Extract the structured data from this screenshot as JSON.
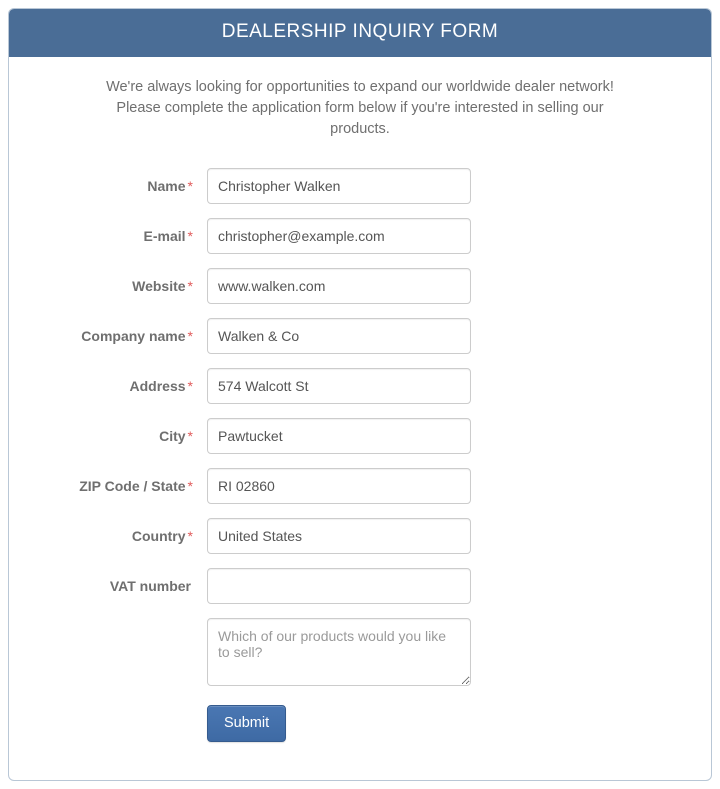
{
  "header": {
    "title": "DEALERSHIP INQUIRY FORM"
  },
  "intro": "We're always looking for opportunities to expand our worldwide dealer network! Please complete the application form below if you're interested in selling our products.",
  "fields": {
    "name": {
      "label": "Name",
      "value": "Christopher Walken",
      "required": "*"
    },
    "email": {
      "label": "E-mail",
      "value": "christopher@example.com",
      "required": "*"
    },
    "website": {
      "label": "Website",
      "value": "www.walken.com",
      "required": "*"
    },
    "company": {
      "label": "Company name",
      "value": "Walken & Co",
      "required": "*"
    },
    "address": {
      "label": "Address",
      "value": "574 Walcott St",
      "required": "*"
    },
    "city": {
      "label": "City",
      "value": "Pawtucket",
      "required": "*"
    },
    "zip": {
      "label": "ZIP Code / State",
      "value": "RI 02860",
      "required": "*"
    },
    "country": {
      "label": "Country",
      "value": "United States",
      "required": "*"
    },
    "vat": {
      "label": "VAT number",
      "value": "",
      "required": ""
    },
    "message": {
      "placeholder": "Which of our products would you like to sell?"
    }
  },
  "submit": {
    "label": "Submit"
  }
}
